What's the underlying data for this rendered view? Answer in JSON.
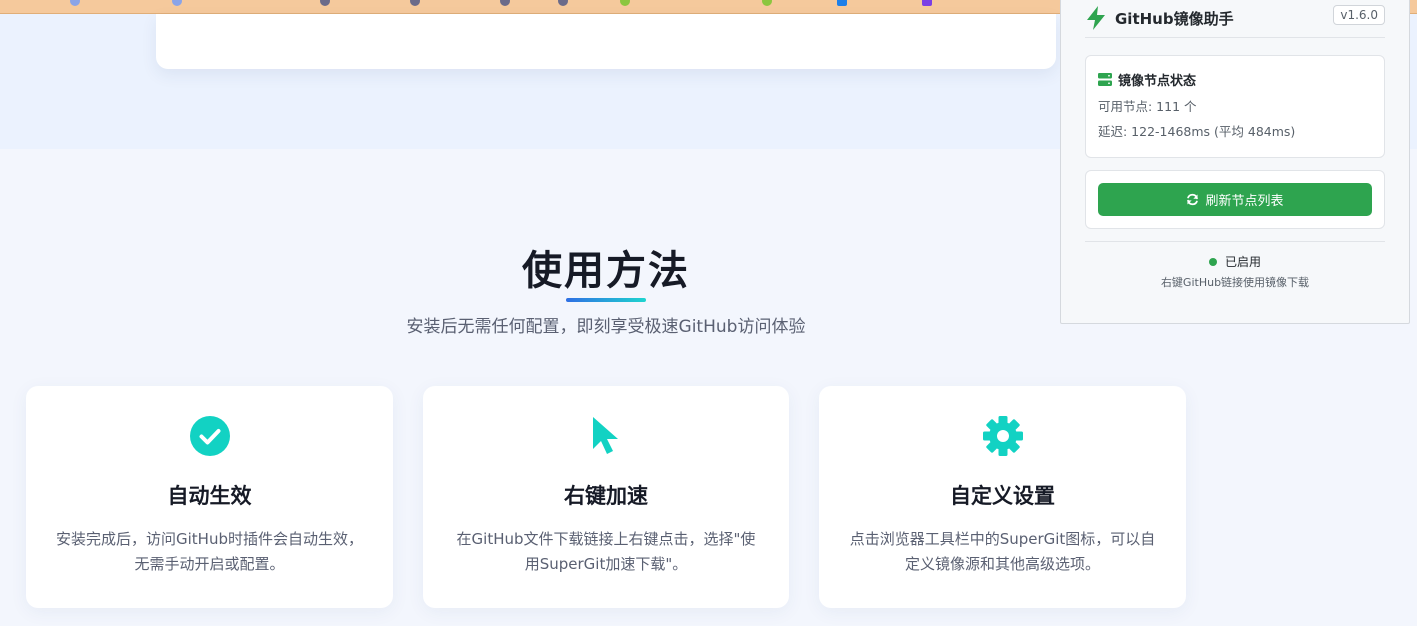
{
  "colors": {
    "accent_green": "#2ea44f",
    "feature_icon": "#12d2c3",
    "title_gradient_start": "#2f6fe4",
    "title_gradient_end": "#1ed4cf",
    "bolt": "#2ea44f"
  },
  "section": {
    "title": "使用方法",
    "subtitle": "安装后无需任何配置，即刻享受极速GitHub访问体验"
  },
  "features": [
    {
      "icon": "check-circle-icon",
      "title": "自动生效",
      "desc": "安装完成后，访问GitHub时插件会自动生效，无需手动开启或配置。"
    },
    {
      "icon": "cursor-pointer-icon",
      "title": "右键加速",
      "desc": "在GitHub文件下载链接上右键点击，选择\"使用SuperGit加速下载\"。"
    },
    {
      "icon": "gear-icon",
      "title": "自定义设置",
      "desc": "点击浏览器工具栏中的SuperGit图标，可以自定义镜像源和其他高级选项。"
    }
  ],
  "popup": {
    "title": "GitHub镜像助手",
    "version": "v1.6.0",
    "status_title": "镜像节点状态",
    "available_nodes": "可用节点: 111 个",
    "latency": "延迟: 122-1468ms (平均 484ms)",
    "refresh_label": "刷新节点列表",
    "enabled_label": "已启用",
    "hint": "右键GitHub链接使用镜像下载"
  }
}
